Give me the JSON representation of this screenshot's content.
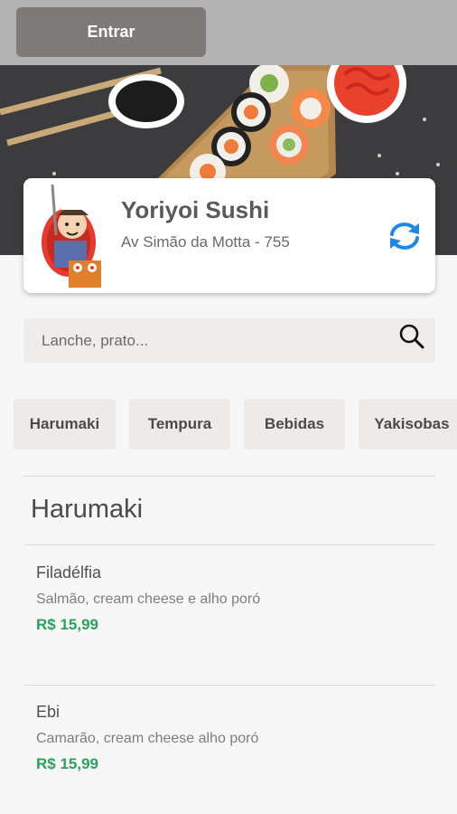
{
  "header": {
    "login_label": "Entrar"
  },
  "store": {
    "name": "Yoriyoi Sushi",
    "address": "Av Simão da Motta - 755"
  },
  "search": {
    "placeholder": "Lanche, prato..."
  },
  "categories": [
    {
      "label": "Harumaki"
    },
    {
      "label": "Tempura"
    },
    {
      "label": "Bebidas"
    },
    {
      "label": "Yakisobas"
    }
  ],
  "menu": {
    "section_title": "Harumaki",
    "items": [
      {
        "name": "Filadélfia",
        "description": "Salmão, cream cheese e alho poró",
        "price": "R$ 15,99"
      },
      {
        "name": "Ebi",
        "description": "Camarão, cream cheese alho poró",
        "price": "R$ 15,99"
      }
    ]
  },
  "colors": {
    "price": "#2aa15d",
    "refresh": "#1e88e5",
    "topbar": "#b3b3b3",
    "button": "#7d7a78"
  },
  "icons": {
    "refresh": "refresh-icon",
    "search": "search-icon"
  }
}
